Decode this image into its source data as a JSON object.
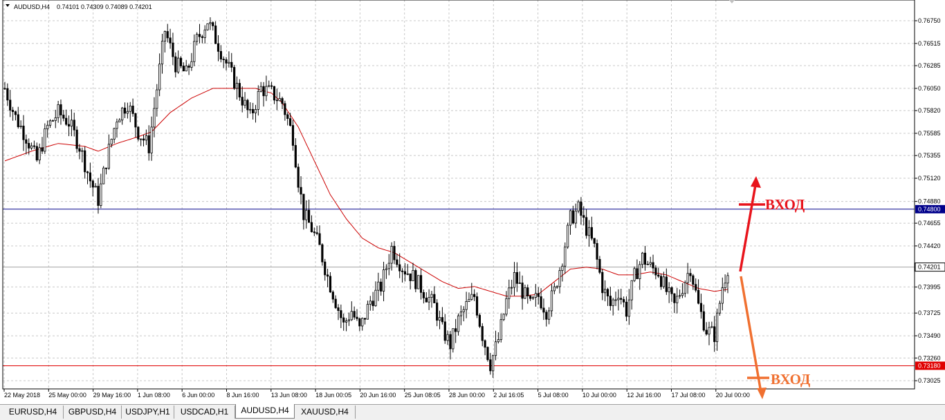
{
  "header": {
    "symbol": "AUDUSD,H4",
    "ohlc": "0.74101 0.74309 0.74089 0.74201"
  },
  "tabs": [
    {
      "label": "EURUSD,H4",
      "active": false
    },
    {
      "label": "GBPUSD,H4",
      "active": false
    },
    {
      "label": "USDJPY,H1",
      "active": false
    },
    {
      "label": "USDCAD,H1",
      "active": false
    },
    {
      "label": "AUDUSD,H4",
      "active": true
    },
    {
      "label": "XAUUSD,H4",
      "active": false
    }
  ],
  "chart_data": {
    "type": "candlestick",
    "symbol": "AUDUSD",
    "timeframe": "H4",
    "ylim": [
      0.73,
      0.7685
    ],
    "grid": true,
    "price_ticks": [
      "0.76750",
      "0.76515",
      "0.76285",
      "0.76050",
      "0.75820",
      "0.75585",
      "0.75355",
      "0.75120",
      "0.74880",
      "0.74655",
      "0.74420",
      "0.74201",
      "0.73995",
      "0.73725",
      "0.73490",
      "0.73260",
      "0.73180",
      "0.73025"
    ],
    "time_labels": [
      "22 May 2018",
      "25 May 00:00",
      "29 May 16:00",
      "1 Jun 08:00",
      "6 Jun 00:00",
      "8 Jun 16:00",
      "13 Jun 08:00",
      "18 Jun 00:05",
      "20 Jun 16:00",
      "25 Jun 08:05",
      "28 Jun 00:00",
      "2 Jul 16:05",
      "5 Jul 08:00",
      "10 Jul 00:00",
      "12 Jul 16:00",
      "17 Jul 08:00",
      "20 Jul 00:00"
    ],
    "horizontal_lines": [
      {
        "price": 0.748,
        "label": "0.74800",
        "color": "#00008b"
      },
      {
        "price": 0.7318,
        "label": "0.73180",
        "color": "#e00000"
      }
    ],
    "current_price": {
      "value": 0.74201,
      "label": "0.74201"
    },
    "moving_average_color": "#cc0000",
    "candles_color": "#000000",
    "price_path": [
      [
        0,
        0.7605
      ],
      [
        4,
        0.7575
      ],
      [
        8,
        0.7555
      ],
      [
        12,
        0.753
      ],
      [
        16,
        0.7565
      ],
      [
        20,
        0.758
      ],
      [
        24,
        0.757
      ],
      [
        28,
        0.7545
      ],
      [
        32,
        0.751
      ],
      [
        35,
        0.749
      ],
      [
        38,
        0.753
      ],
      [
        42,
        0.7575
      ],
      [
        46,
        0.759
      ],
      [
        50,
        0.756
      ],
      [
        54,
        0.7545
      ],
      [
        57,
        0.7605
      ],
      [
        60,
        0.7665
      ],
      [
        64,
        0.763
      ],
      [
        68,
        0.762
      ],
      [
        72,
        0.7655
      ],
      [
        76,
        0.7675
      ],
      [
        80,
        0.765
      ],
      [
        84,
        0.7625
      ],
      [
        88,
        0.76
      ],
      [
        92,
        0.7575
      ],
      [
        96,
        0.7605
      ],
      [
        100,
        0.76
      ],
      [
        104,
        0.759
      ],
      [
        108,
        0.7555
      ],
      [
        110,
        0.751
      ],
      [
        112,
        0.7475
      ],
      [
        115,
        0.746
      ],
      [
        118,
        0.744
      ],
      [
        121,
        0.741
      ],
      [
        124,
        0.7385
      ],
      [
        127,
        0.736
      ],
      [
        130,
        0.7375
      ],
      [
        133,
        0.7355
      ],
      [
        137,
        0.7385
      ],
      [
        141,
        0.74
      ],
      [
        145,
        0.744
      ],
      [
        149,
        0.742
      ],
      [
        153,
        0.741
      ],
      [
        157,
        0.7395
      ],
      [
        161,
        0.738
      ],
      [
        164,
        0.7355
      ],
      [
        167,
        0.734
      ],
      [
        170,
        0.7365
      ],
      [
        173,
        0.738
      ],
      [
        176,
        0.739
      ],
      [
        179,
        0.735
      ],
      [
        182,
        0.732
      ],
      [
        185,
        0.7345
      ],
      [
        188,
        0.7385
      ],
      [
        191,
        0.741
      ],
      [
        194,
        0.7395
      ],
      [
        197,
        0.738
      ],
      [
        200,
        0.739
      ],
      [
        203,
        0.7375
      ],
      [
        206,
        0.7395
      ],
      [
        209,
        0.743
      ],
      [
        212,
        0.747
      ],
      [
        215,
        0.748
      ],
      [
        218,
        0.746
      ],
      [
        221,
        0.744
      ],
      [
        224,
        0.74
      ],
      [
        227,
        0.738
      ],
      [
        230,
        0.7395
      ],
      [
        233,
        0.7375
      ],
      [
        236,
        0.741
      ],
      [
        239,
        0.743
      ],
      [
        242,
        0.742
      ],
      [
        245,
        0.7415
      ],
      [
        248,
        0.7395
      ],
      [
        251,
        0.738
      ],
      [
        254,
        0.74
      ],
      [
        257,
        0.742
      ],
      [
        260,
        0.738
      ],
      [
        263,
        0.7355
      ],
      [
        266,
        0.735
      ],
      [
        269,
        0.74
      ],
      [
        271,
        0.742
      ]
    ],
    "ma_path": [
      [
        0,
        0.753
      ],
      [
        10,
        0.754
      ],
      [
        20,
        0.7548
      ],
      [
        30,
        0.7545
      ],
      [
        35,
        0.754
      ],
      [
        42,
        0.7548
      ],
      [
        50,
        0.7555
      ],
      [
        55,
        0.756
      ],
      [
        62,
        0.758
      ],
      [
        70,
        0.7595
      ],
      [
        78,
        0.7605
      ],
      [
        86,
        0.7605
      ],
      [
        94,
        0.7605
      ],
      [
        100,
        0.76
      ],
      [
        104,
        0.759
      ],
      [
        110,
        0.7565
      ],
      [
        116,
        0.753
      ],
      [
        122,
        0.7495
      ],
      [
        128,
        0.747
      ],
      [
        134,
        0.745
      ],
      [
        140,
        0.744
      ],
      [
        146,
        0.7435
      ],
      [
        152,
        0.7425
      ],
      [
        158,
        0.7415
      ],
      [
        164,
        0.7405
      ],
      [
        170,
        0.7398
      ],
      [
        176,
        0.74
      ],
      [
        182,
        0.7395
      ],
      [
        188,
        0.739
      ],
      [
        194,
        0.739
      ],
      [
        200,
        0.7392
      ],
      [
        206,
        0.7405
      ],
      [
        212,
        0.7418
      ],
      [
        218,
        0.742
      ],
      [
        224,
        0.7418
      ],
      [
        230,
        0.7412
      ],
      [
        236,
        0.7412
      ],
      [
        242,
        0.7415
      ],
      [
        248,
        0.7412
      ],
      [
        254,
        0.7405
      ],
      [
        260,
        0.7398
      ],
      [
        266,
        0.7395
      ],
      [
        271,
        0.7397
      ]
    ],
    "annotations": [
      {
        "text": "ВХОД",
        "direction": "up",
        "color": "#e8141c"
      },
      {
        "text": "ВХОД",
        "direction": "down",
        "color": "#f07030"
      }
    ]
  }
}
